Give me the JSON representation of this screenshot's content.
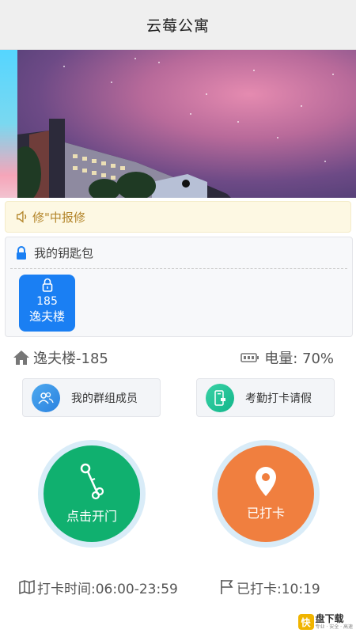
{
  "header": {
    "title": "云莓公寓"
  },
  "notice": {
    "text": "修\"中报修"
  },
  "wallet": {
    "title": "我的钥匙包",
    "keys": [
      {
        "room": "185",
        "building": "逸夫楼"
      }
    ]
  },
  "status": {
    "room": "逸夫楼-185",
    "battery": "电量: 70%"
  },
  "actions": {
    "group_members": "我的群组成员",
    "attendance_leave": "考勤打卡请假"
  },
  "main_buttons": {
    "open_door": "点击开门",
    "checked_in": "已打卡"
  },
  "footer": {
    "checkin_time": "打卡时间:06:00-23:59",
    "checked_at": "已打卡:10:19"
  },
  "watermark": {
    "mark": "快",
    "title": "盘下载",
    "subtitle": "专业 · 安全 · 高速"
  },
  "colors": {
    "accent_blue": "#1a7ff3",
    "door_green": "#10b06f",
    "checkin_orange": "#f07f3f",
    "notice_text": "#b3852a"
  },
  "icons": [
    "speaker-icon",
    "lock-icon",
    "home-icon",
    "battery-icon",
    "group-icon",
    "attendance-icon",
    "key-icon",
    "location-pin-icon",
    "map-icon",
    "flag-icon"
  ]
}
